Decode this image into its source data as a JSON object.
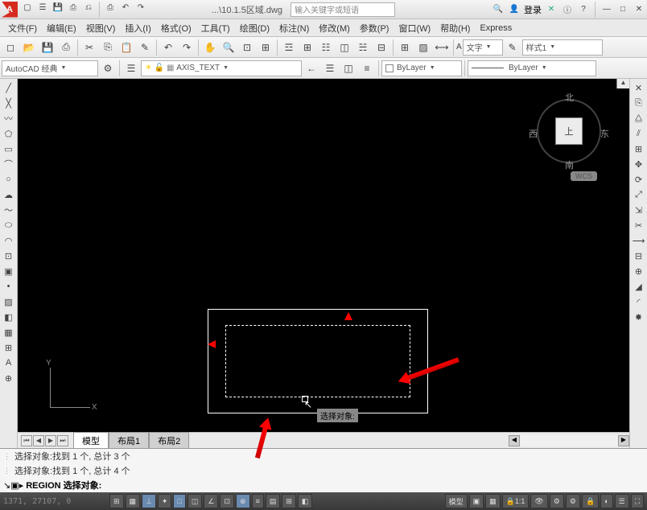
{
  "title": {
    "app_icon": "A",
    "filename": "...\\10.1.5区域.dwg",
    "search_placeholder": "输入关键字或短语",
    "login": "登录"
  },
  "menu": {
    "items": [
      "文件(F)",
      "编辑(E)",
      "视图(V)",
      "插入(I)",
      "格式(O)",
      "工具(T)",
      "绘图(D)",
      "标注(N)",
      "修改(M)",
      "参数(P)",
      "窗口(W)",
      "帮助(H)",
      "Express"
    ]
  },
  "toolbar2": {
    "text_label": "文字",
    "style_label": "样式1"
  },
  "toolbar3": {
    "workspace": "AutoCAD 经典",
    "layer": "AXIS_TEXT",
    "layercolor": "ByLayer",
    "linetype": "ByLayer"
  },
  "viewport": {
    "compass_n": "北",
    "compass_s": "南",
    "compass_e": "东",
    "compass_w": "西",
    "compass_top": "上",
    "wcs": "WCS",
    "ucs_x": "X",
    "ucs_y": "Y",
    "tooltip": "选择对象:"
  },
  "tabs": {
    "items": [
      "模型",
      "布局1",
      "布局2"
    ],
    "active": 0
  },
  "cmd": {
    "line1": "选择对象:找到 1 个, 总计 3 个",
    "line2": "选择对象:找到 1 个, 总计 4 个",
    "prompt": "REGION 选择对象:"
  },
  "status": {
    "coords": "1371, 27107, 0",
    "model": "模型",
    "scale": "1:1"
  }
}
